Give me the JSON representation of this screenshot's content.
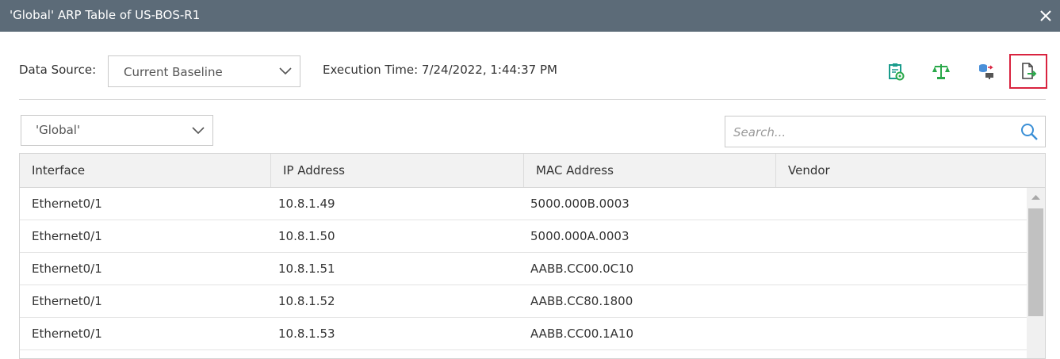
{
  "window": {
    "title": "'Global' ARP Table of US-BOS-R1",
    "close_icon": "close-icon"
  },
  "toolbar": {
    "data_source_label": "Data Source:",
    "data_source_value": "Current Baseline",
    "execution_time": "Execution Time: 7/24/2022, 1:44:37 PM",
    "tools": [
      {
        "icon": "clipboard-refresh-icon",
        "color": "#1a9c8c"
      },
      {
        "icon": "balance-scale-icon",
        "color": "#2aa84a"
      },
      {
        "icon": "database-to-device-icon",
        "color": "#4a90d9"
      },
      {
        "icon": "export-file-icon",
        "color": "#2aa84a",
        "selected": true
      }
    ]
  },
  "filter": {
    "scope_value": "'Global'",
    "search_placeholder": "Search...",
    "search_icon": "search-icon"
  },
  "table": {
    "columns": [
      "Interface",
      "IP Address",
      "MAC Address",
      "Vendor"
    ],
    "rows": [
      [
        "Ethernet0/1",
        "10.8.1.49",
        "5000.000B.0003",
        ""
      ],
      [
        "Ethernet0/1",
        "10.8.1.50",
        "5000.000A.0003",
        ""
      ],
      [
        "Ethernet0/1",
        "10.8.1.51",
        "AABB.CC00.0C10",
        ""
      ],
      [
        "Ethernet0/1",
        "10.8.1.52",
        "AABB.CC80.1800",
        ""
      ],
      [
        "Ethernet0/1",
        "10.8.1.53",
        "AABB.CC00.1A10",
        ""
      ]
    ]
  },
  "colors": {
    "titlebar": "#5c6b78",
    "selected_border": "#d9233f",
    "accent_blue": "#3a8fd6"
  }
}
